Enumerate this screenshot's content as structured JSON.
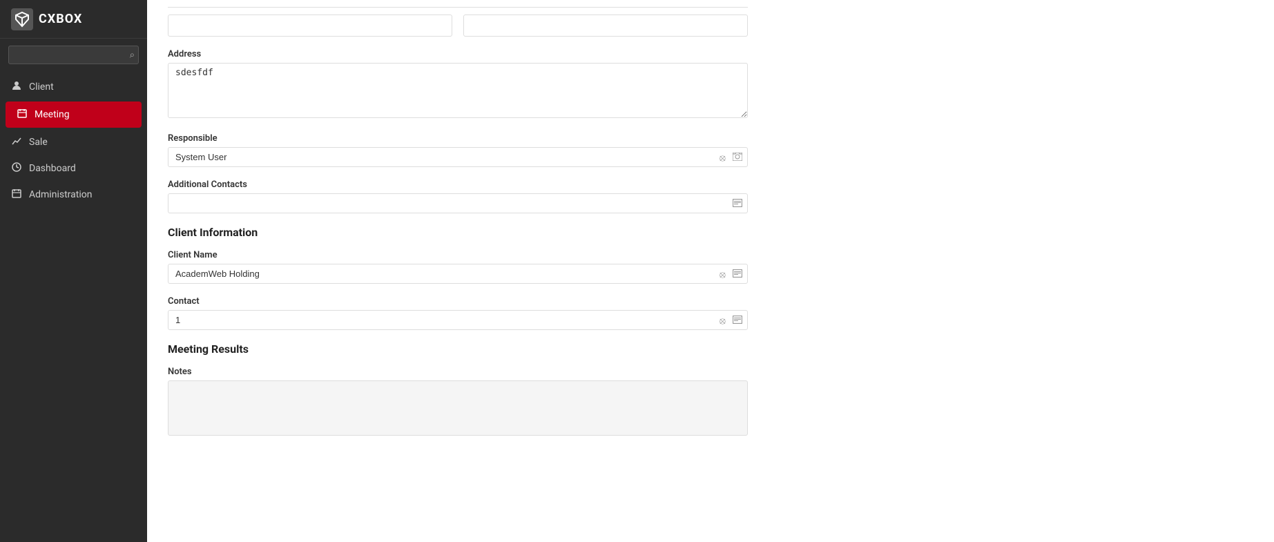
{
  "app": {
    "logo_text": "CXBOX"
  },
  "sidebar": {
    "search_placeholder": "",
    "items": [
      {
        "id": "client",
        "label": "Client",
        "icon": "user",
        "active": false
      },
      {
        "id": "meeting",
        "label": "Meeting",
        "icon": "calendar",
        "active": true
      },
      {
        "id": "sale",
        "label": "Sale",
        "icon": "chart",
        "active": false
      },
      {
        "id": "dashboard",
        "label": "Dashboard",
        "icon": "clock",
        "active": false
      },
      {
        "id": "administration",
        "label": "Administration",
        "icon": "calendar2",
        "active": false
      }
    ]
  },
  "form": {
    "address_label": "Address",
    "address_value": "sdesfdf",
    "responsible_label": "Responsible",
    "responsible_value": "System User",
    "additional_contacts_label": "Additional Contacts",
    "additional_contacts_value": "",
    "client_information_title": "Client Information",
    "client_name_label": "Client Name",
    "client_name_value": "AcademWeb Holding",
    "contact_label": "Contact",
    "contact_value": "1",
    "meeting_results_title": "Meeting Results",
    "notes_label": "Notes",
    "notes_value": ""
  }
}
